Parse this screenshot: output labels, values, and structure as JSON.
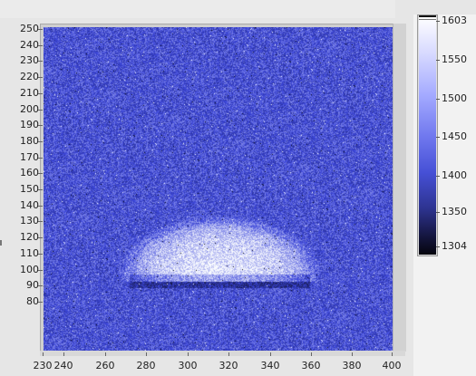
{
  "graph": {
    "y_axis": {
      "ticks": [
        "250",
        "240",
        "230",
        "220",
        "210",
        "200",
        "190",
        "180",
        "170",
        "160",
        "150",
        "140",
        "130",
        "120",
        "110",
        "100",
        "90",
        "80"
      ]
    },
    "x_axis": {
      "ticks": [
        "230",
        "240",
        "260",
        "280",
        "300",
        "320",
        "340",
        "360",
        "380",
        "400"
      ]
    },
    "colors": {
      "background": "#3f49d8",
      "blob": "#e6e8ff",
      "dark": "#05050d"
    }
  },
  "colorbar": {
    "max_label": "1603",
    "labels": [
      "1550",
      "1500",
      "1450",
      "1400",
      "1350"
    ],
    "min_label": "1304"
  }
}
